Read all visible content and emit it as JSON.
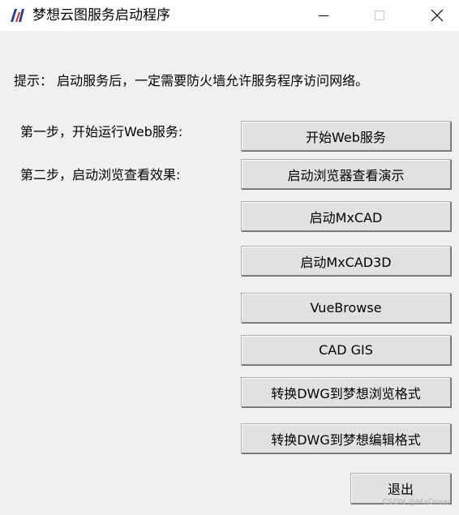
{
  "window": {
    "title": "梦想云图服务启动程序",
    "controls": {
      "minimize_icon": "minimize-icon",
      "maximize_icon": "maximize-icon",
      "close_icon": "close-icon"
    },
    "app_icon": "mxdraw-logo-icon"
  },
  "hint": "提示： 启动服务后，一定需要防火墙允许服务程序访问网络。",
  "steps": {
    "step1": "第一步，开始运行Web服务:",
    "step2": "第二步，启动浏览查看效果:"
  },
  "buttons": {
    "start_web": "开始Web服务",
    "browser_demo": "启动浏览器查看演示",
    "mxcad": "启动MxCAD",
    "mxcad3d": "启动MxCAD3D",
    "vuebrowse": "VueBrowse",
    "cadgis": "CAD GIS",
    "convert_dwg_view": "转换DWG到梦想浏览格式",
    "convert_dwg_edit": "转换DWG到梦想编辑格式",
    "exit": "退出"
  },
  "watermark": "CSDN @MxDraw",
  "colors": {
    "background": "#f0f0f0",
    "titlebar": "#ffffff",
    "button": "#e1e1e1",
    "logo_dark": "#2d3f8f",
    "logo_red": "#d12a2a"
  }
}
